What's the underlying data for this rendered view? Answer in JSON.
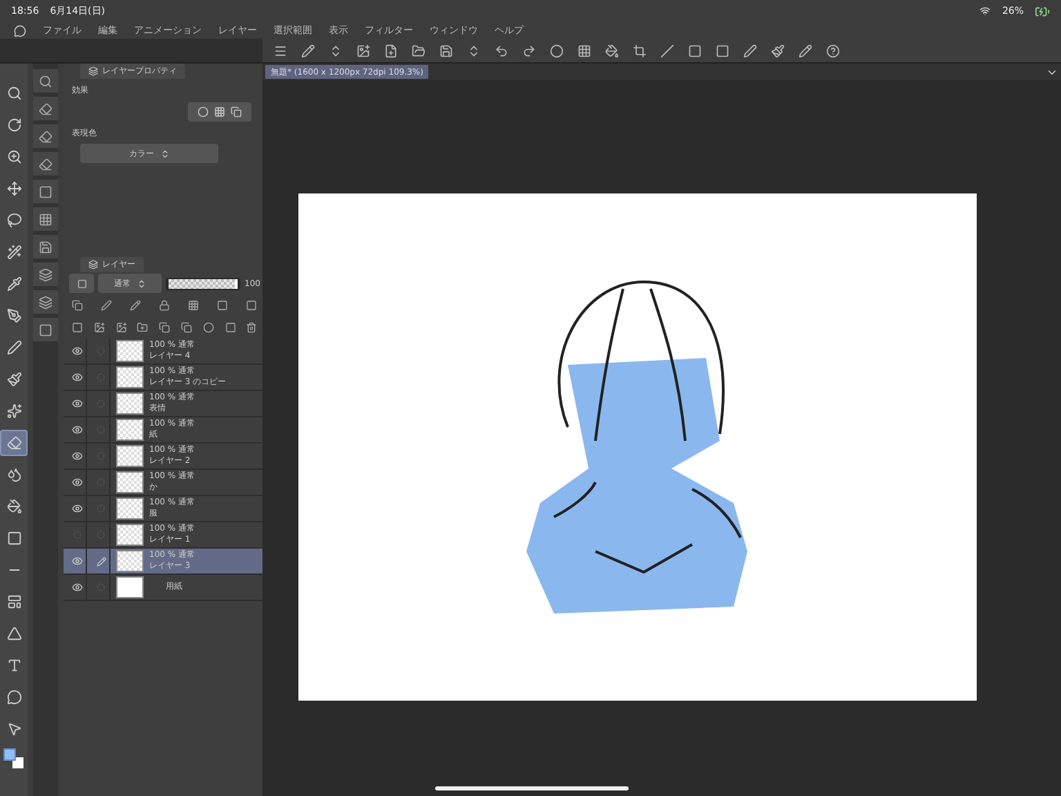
{
  "status_bar": {
    "time": "18:56",
    "date": "6月14日(日)",
    "battery": "26%"
  },
  "menu": [
    "ファイル",
    "編集",
    "アニメーション",
    "レイヤー",
    "選択範囲",
    "表示",
    "フィルター",
    "ウィンドウ",
    "ヘルプ"
  ],
  "document_tab": {
    "title": "無題* (1600 x 1200px 72dpi 109.3%)",
    "selected": true
  },
  "tools": [
    {
      "selected": false
    },
    {
      "selected": false
    },
    {
      "selected": false
    },
    {
      "selected": false
    },
    {
      "selected": false
    },
    {
      "selected": false
    },
    {
      "selected": false
    },
    {
      "selected": false
    },
    {
      "selected": false
    },
    {
      "selected": false
    },
    {
      "selected": false
    },
    {
      "selected": true
    },
    {
      "selected": false
    },
    {
      "selected": false
    },
    {
      "selected": false
    },
    {
      "selected": false
    },
    {
      "selected": false
    },
    {
      "selected": false
    },
    {
      "selected": false
    },
    {
      "selected": false
    },
    {
      "selected": false
    }
  ],
  "layer_property": {
    "tab": "レイヤープロパティ",
    "effect_label": "効果",
    "color_label": "表現色",
    "color_mode": "カラー"
  },
  "layer_panel": {
    "tab": "レイヤー",
    "blend_mode": "通常",
    "opacity": "100",
    "level": 1
  },
  "layers": [
    {
      "kind": "raster",
      "mode": "100 % 通常",
      "name": "レイヤー 4",
      "visible": true,
      "selected": false
    },
    {
      "kind": "raster",
      "mode": "100 % 通常",
      "name": "レイヤー 3 のコピー",
      "visible": true,
      "selected": false
    },
    {
      "kind": "raster",
      "mode": "100 % 通常",
      "name": "表情",
      "visible": true,
      "selected": false
    },
    {
      "kind": "raster",
      "mode": "100 % 通常",
      "name": "紙",
      "visible": true,
      "selected": false
    },
    {
      "kind": "raster",
      "mode": "100 % 通常",
      "name": "レイヤー 2",
      "visible": true,
      "selected": false
    },
    {
      "kind": "raster",
      "mode": "100 % 通常",
      "name": "か",
      "visible": true,
      "selected": false
    },
    {
      "kind": "raster",
      "mode": "100 % 通常",
      "name": "服",
      "visible": true,
      "selected": false
    },
    {
      "kind": "raster",
      "mode": "100 % 通常",
      "name": "レイヤー 1",
      "visible": false,
      "selected": false
    },
    {
      "kind": "raster",
      "mode": "100 % 通常",
      "name": "レイヤー 3",
      "visible": true,
      "selected": true
    },
    {
      "kind": "paper",
      "name": "用紙",
      "visible": true,
      "selected": false
    }
  ]
}
